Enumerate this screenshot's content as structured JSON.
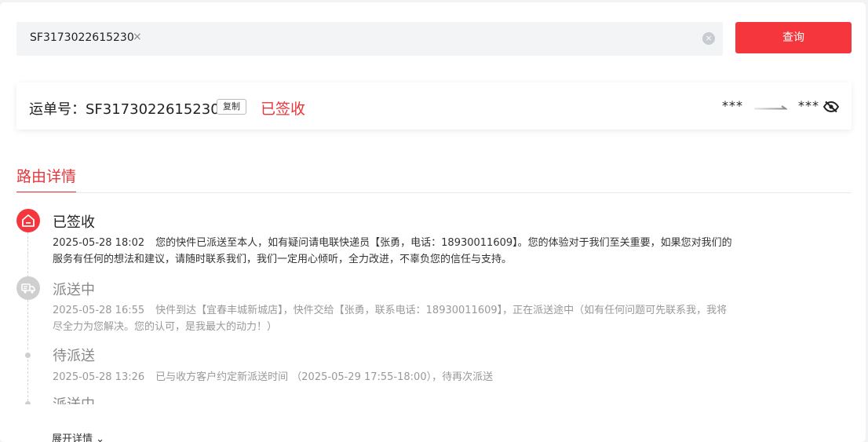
{
  "search": {
    "tag_value": "SF3173022615230",
    "tag_remove": "×",
    "clear": "×",
    "button_label": "查询"
  },
  "waybill": {
    "label": "运单号：SF3173022615230",
    "copy_label": "复制",
    "status": "已签收",
    "from": "***",
    "to": "***"
  },
  "section": {
    "tab_label": "路由详情"
  },
  "timeline": [
    {
      "title": "已签收",
      "time": "2025-05-28 18:02",
      "text": "您的快件已派送至本人，如有疑问请电联快递员【张勇，电话：18930011609】。您的体验对于我们至关重要，如果您对我们的服务有任何的想法和建议，请随时联系我们，我们一定用心倾听，全力改进，不辜负您的信任与支持。",
      "icon": "home-icon"
    },
    {
      "title": "派送中",
      "time": "2025-05-28 16:55",
      "text": "快件到达【宜春丰城新城店】，快件交给【张勇，联系电话：18930011609】，正在派送途中（如有任何问题可先联系我，我将尽全力为您解决。您的认可，是我最大的动力！）",
      "icon": "truck-icon"
    },
    {
      "title": "待派送",
      "time": "2025-05-28 13:26",
      "text": "已与收方客户约定新派送时间 （2025-05-29 17:55-18:00），待再次派送",
      "icon": "dot"
    },
    {
      "title": "派送中",
      "time": "",
      "text": "",
      "icon": "dot"
    }
  ],
  "expand_label": "展开详情",
  "colors": {
    "accent": "#f5373d",
    "status_red": "#e8353a"
  }
}
